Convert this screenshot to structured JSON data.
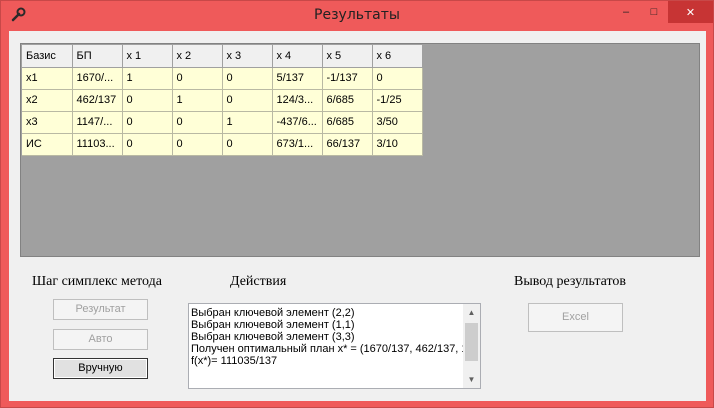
{
  "window": {
    "title": "Результаты",
    "controls": {
      "minimize": "–",
      "maximize": "□",
      "close": "✕"
    }
  },
  "grid": {
    "columns": [
      "Базис",
      "БП",
      "x 1",
      "x 2",
      "x 3",
      "x 4",
      "x 5",
      "x 6"
    ],
    "rows": [
      [
        "x1",
        "1670/...",
        "1",
        "0",
        "0",
        "5/137",
        "-1/137",
        "0"
      ],
      [
        "x2",
        "462/137",
        "0",
        "1",
        "0",
        "124/3...",
        "6/685",
        "-1/25"
      ],
      [
        "x3",
        "1147/...",
        "0",
        "0",
        "1",
        "-437/6...",
        "6/685",
        "3/50"
      ],
      [
        "ИС",
        "11103...",
        "0",
        "0",
        "0",
        "673/1...",
        "66/137",
        "3/10"
      ]
    ]
  },
  "labels": {
    "steps": "Шаг симплекс метода",
    "actions": "Действия",
    "output": "Вывод результатов"
  },
  "buttons": {
    "result": "Результат",
    "auto": "Авто",
    "manual": "Вручную",
    "excel": "Excel"
  },
  "log": {
    "lines": [
      "Выбран ключевой элемент (2,2)",
      "Выбран ключевой элемент (1,1)",
      "Выбран ключевой элемент (3,3)",
      "Получен оптимальный план x* = (1670/137, 462/137, 1",
      "f(x*)= 111035/137"
    ]
  }
}
